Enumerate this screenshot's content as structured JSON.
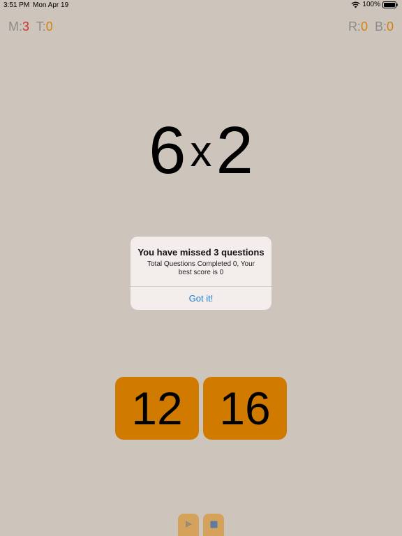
{
  "status_bar": {
    "time": "3:51 PM",
    "date": "Mon Apr 19",
    "battery": "100%",
    "icons": [
      "wifi-icon",
      "battery-icon"
    ]
  },
  "scores": {
    "missed_label": "M:",
    "missed_value": "3",
    "total_label": "T:",
    "total_value": "0",
    "right_label": "R:",
    "right_value": "0",
    "best_label": "B:",
    "best_value": "0"
  },
  "question": {
    "left": "6",
    "operator": "x",
    "right": "2"
  },
  "alert": {
    "title": "You have missed 3 questions",
    "message": "Total Questions Completed 0, Your best score is 0",
    "button": "Got it!"
  },
  "answers": [
    "12",
    "16"
  ],
  "controls": {
    "icons": [
      "play-icon",
      "stop-icon"
    ]
  },
  "colors": {
    "background": "#cdc5bb",
    "answer_tile": "#d17a00",
    "control_button": "#d4a25a",
    "missed_value": "#d0312d",
    "score_value": "#d4800f",
    "link_blue": "#1a7bd6"
  }
}
